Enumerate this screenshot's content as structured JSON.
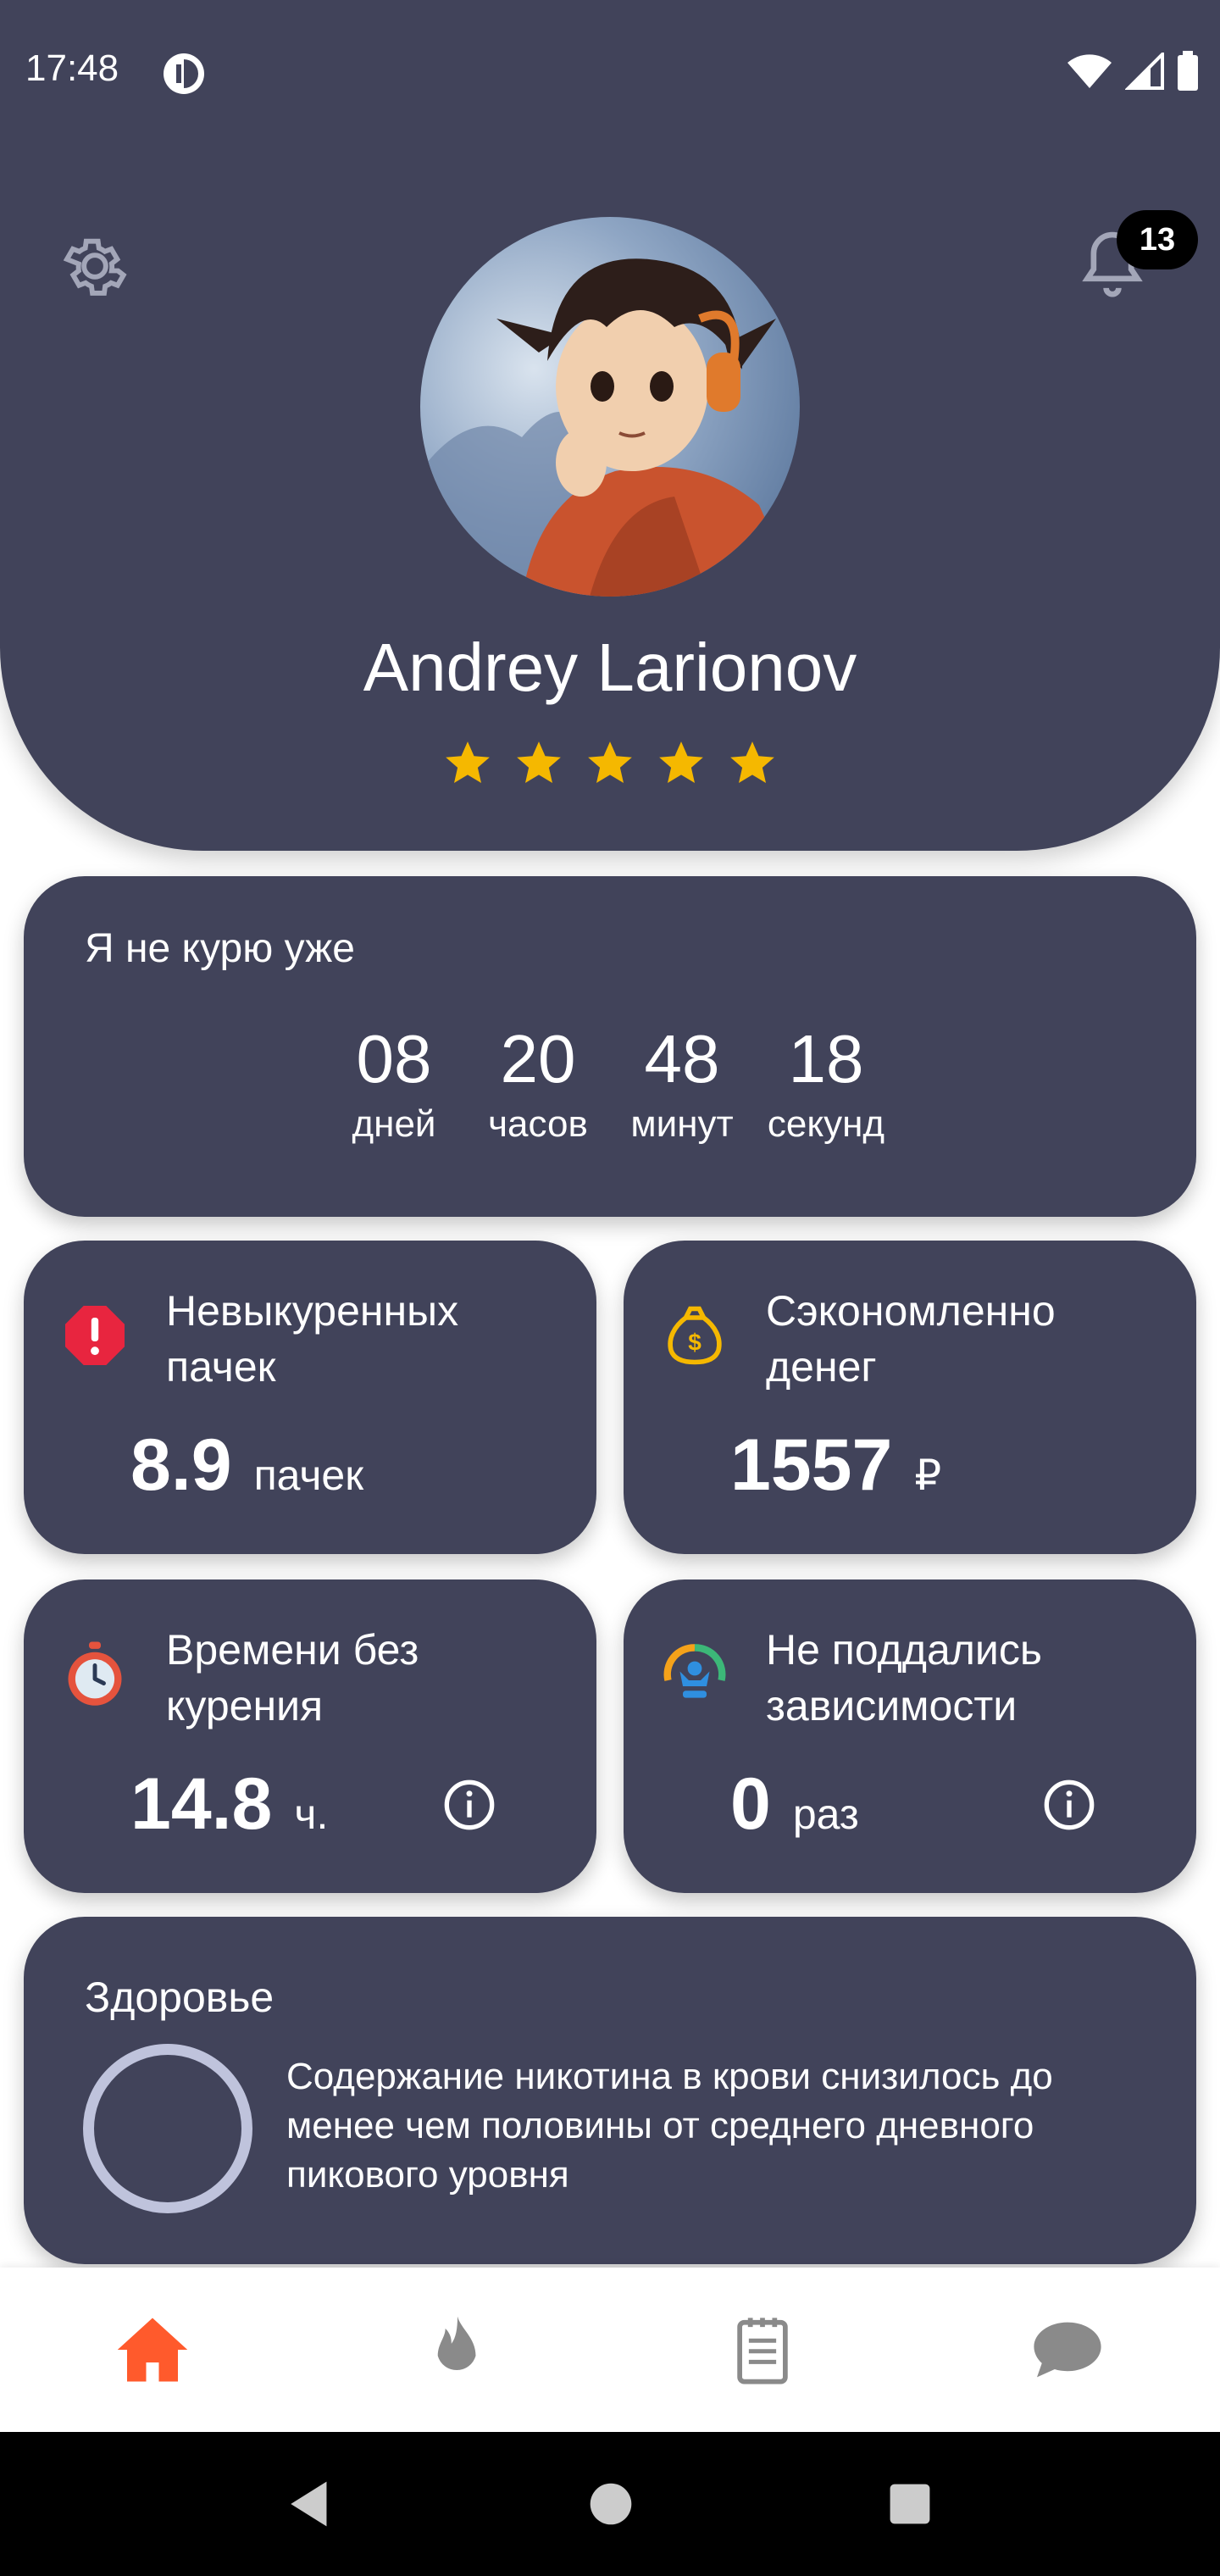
{
  "status_bar": {
    "time": "17:48"
  },
  "header": {
    "user_name": "Andrey Larionov",
    "rating": 5,
    "notifications_count": "13",
    "icons": {
      "settings": "gear-icon",
      "notifications": "bell-icon"
    }
  },
  "timer": {
    "title": "Я не курю уже",
    "cells": [
      {
        "value": "08",
        "unit": "дней"
      },
      {
        "value": "20",
        "unit": "часов"
      },
      {
        "value": "48",
        "unit": "минут"
      },
      {
        "value": "18",
        "unit": "секунд"
      }
    ]
  },
  "stats": [
    {
      "label": "Невыкуренных пачек",
      "value": "8.9",
      "unit": "пачек",
      "icon": "warning-icon"
    },
    {
      "label": "Сэкономленно денег",
      "value": "1557",
      "unit": "₽",
      "icon": "money-bag-icon"
    },
    {
      "label": "Времени без курения",
      "value": "14.8",
      "unit": "ч.",
      "icon": "stopwatch-icon",
      "info": "info-icon"
    },
    {
      "label": "Не поддались зависимости",
      "value": "0",
      "unit": "раз",
      "icon": "resist-icon",
      "info": "info-icon"
    }
  ],
  "health": {
    "title": "Здоровье",
    "text": "Содержание никотина в крови снизилось до менее чем половины от среднего дневного пикового уровня"
  },
  "bottom_nav": {
    "active_color": "#ff5a2c",
    "inactive_color": "#8a8a8a",
    "items": [
      "home-icon",
      "flame-icon",
      "notepad-icon",
      "chat-icon"
    ]
  },
  "colors": {
    "card": "#41435a",
    "star": "#f5b800"
  }
}
